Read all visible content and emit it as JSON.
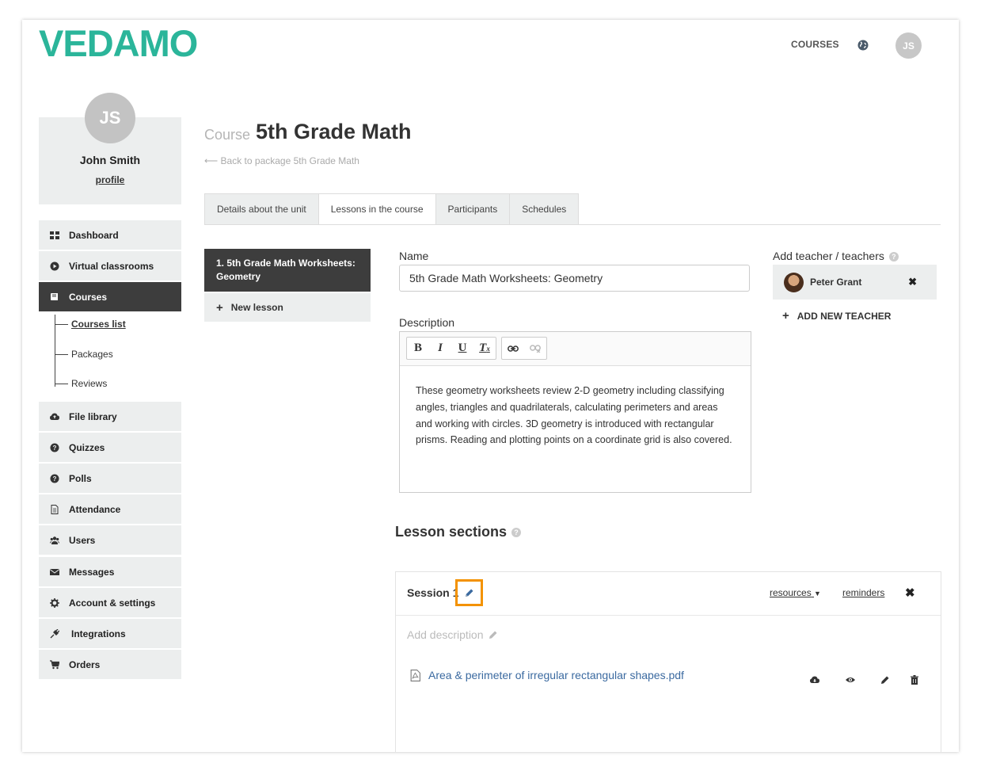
{
  "header": {
    "brand": "VEDAMO",
    "nav_courses": "COURSES",
    "avatar_initials": "JS"
  },
  "profile": {
    "initials": "JS",
    "name": "John Smith",
    "link": "profile"
  },
  "sidebar": {
    "items": [
      {
        "label": "Dashboard",
        "icon": "dashboard-icon"
      },
      {
        "label": "Virtual classrooms",
        "icon": "play-icon"
      },
      {
        "label": "Courses",
        "icon": "book-icon",
        "active": true
      },
      {
        "label": "File library",
        "icon": "cloud-upload-icon"
      },
      {
        "label": "Quizzes",
        "icon": "question-icon"
      },
      {
        "label": "Polls",
        "icon": "question-icon"
      },
      {
        "label": "Attendance",
        "icon": "document-icon"
      },
      {
        "label": "Users",
        "icon": "users-icon"
      },
      {
        "label": "Messages",
        "icon": "envelope-icon"
      },
      {
        "label": "Account & settings",
        "icon": "gear-icon"
      },
      {
        "label": "Integrations",
        "icon": "plug-icon"
      },
      {
        "label": "Orders",
        "icon": "cart-icon"
      }
    ],
    "sub_items": [
      "Courses list",
      "Packages",
      "Reviews"
    ]
  },
  "page": {
    "course_label": "Course",
    "course_title": "5th Grade Math",
    "back_link": "⟵ Back to package 5th Grade Math"
  },
  "tabs": [
    "Details about the unit",
    "Lessons in the course",
    "Participants",
    "Schedules"
  ],
  "lessons": {
    "current": "1. 5th Grade Math Worksheets: Geometry",
    "new_lesson": "New lesson"
  },
  "form": {
    "name_label": "Name",
    "name_value": "5th Grade Math Worksheets: Geometry",
    "description_label": "Description",
    "description": "These geometry worksheets review 2-D geometry including classifying angles, triangles and quadrilaterals, calculating perimeters and areas and working with circles. 3D geometry is introduced with rectangular prisms.  Reading and plotting points on a coordinate grid is also covered.",
    "toolbar": {
      "bold": "B",
      "italic": "I",
      "underline": "U",
      "clear": "T"
    }
  },
  "teachers": {
    "label": "Add teacher / teachers",
    "list": [
      "Peter Grant"
    ],
    "add_label": "ADD NEW TEACHER"
  },
  "sections": {
    "title": "Lesson sections",
    "session_title": "Session 1",
    "resources": "resources",
    "reminders": "reminders",
    "add_description": "Add description",
    "file_name": "Area & perimeter of irregular rectangular shapes.pdf"
  },
  "colors": {
    "brand": "#2bb59a",
    "active_bg": "#3d3d3d",
    "highlight": "#f39200",
    "link": "#3b6aa0"
  }
}
